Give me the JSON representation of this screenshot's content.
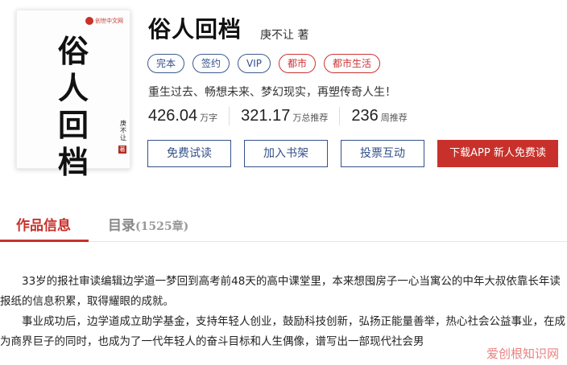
{
  "cover": {
    "logo_text": "创世中文网",
    "title": "俗人回档",
    "author": "庚不让",
    "seal": "著"
  },
  "book": {
    "title": "俗人回档",
    "author_line": "庚不让 著",
    "tags": [
      "完本",
      "签约",
      "VIP",
      "都市",
      "都市生活"
    ],
    "intro": "重生过去、畅想未来、梦幻现实，再塑传奇人生！",
    "stats": [
      {
        "value": "426.04",
        "unit": "万字"
      },
      {
        "value": "321.17",
        "unit": "万总推荐"
      },
      {
        "value": "236",
        "unit": "周推荐"
      }
    ]
  },
  "actions": {
    "free_read": "免费试读",
    "add_shelf": "加入书架",
    "vote": "投票互动",
    "download": "下载APP  新人免费读"
  },
  "tabs": {
    "info": "作品信息",
    "catalog": "目录",
    "catalog_count": "(1525章)"
  },
  "description": {
    "p1": "33岁的报社审读编辑边学道一梦回到高考前48天的高中课堂里，本来想囤房子一心当寓公的中年大叔依靠长年读报纸的信息积累，取得耀眼的成就。",
    "p2": "事业成功后，边学道成立助学基金，支持年轻人创业，鼓励科技创新，弘扬正能量善举，热心社会公益事业，在成为商界巨子的同时，也成为了一代年轻人的奋斗目标和人生偶像，谱写出一部现代社会男"
  },
  "watermark": "爱创根知识网",
  "colors": {
    "accent_red": "#c8312b",
    "accent_blue": "#34518a"
  }
}
